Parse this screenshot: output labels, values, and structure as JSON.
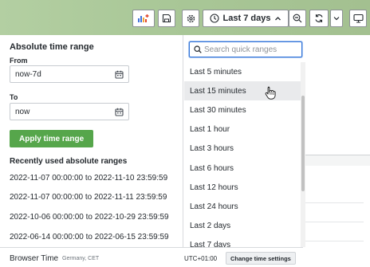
{
  "toolbar": {
    "time_range_label": "Last 7 days",
    "icons": [
      "add-panel-icon",
      "save-icon",
      "gear-icon",
      "clock-icon",
      "chevron-up-icon",
      "zoom-out-icon",
      "refresh-icon",
      "chevron-down-icon",
      "tv-icon"
    ]
  },
  "absolute": {
    "title": "Absolute time range",
    "from_label": "From",
    "from_value": "now-7d",
    "to_label": "To",
    "to_value": "now",
    "apply_label": "Apply time range",
    "recent_title": "Recently used absolute ranges",
    "recent": [
      "2022-11-07 00:00:00 to 2022-11-10 23:59:59",
      "2022-11-07 00:00:00 to 2022-11-11 23:59:59",
      "2022-10-06 00:00:00 to 2022-10-29 23:59:59",
      "2022-06-14 00:00:00 to 2022-06-15 23:59:59"
    ]
  },
  "quick": {
    "search_placeholder": "Search quick ranges",
    "hovered_index": 1,
    "items": [
      "Last 5 minutes",
      "Last 15 minutes",
      "Last 30 minutes",
      "Last 1 hour",
      "Last 3 hours",
      "Last 6 hours",
      "Last 12 hours",
      "Last 24 hours",
      "Last 2 days",
      "Last 7 days"
    ]
  },
  "footer": {
    "browser_time_label": "Browser Time",
    "browser_time_sub": "Germany, CET",
    "utc_offset": "UTC+01:00",
    "change_label": "Change time settings"
  },
  "colors": {
    "toolbar_bg": "#a9c797",
    "apply_button": "#56a64b",
    "search_focus": "#3274d9",
    "hover_row": "#e9eaec"
  }
}
